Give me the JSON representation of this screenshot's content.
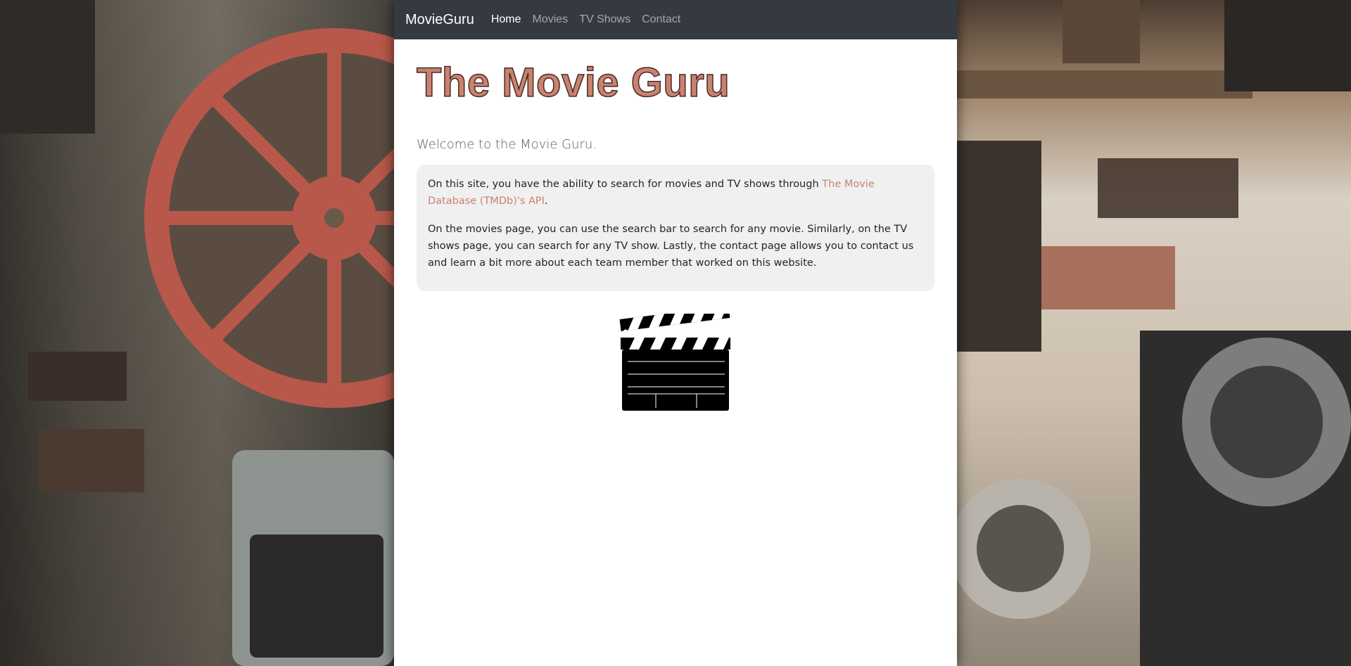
{
  "navbar": {
    "brand": "MovieGuru",
    "links": [
      {
        "label": "Home",
        "active": true
      },
      {
        "label": "Movies",
        "active": false
      },
      {
        "label": "TV Shows",
        "active": false
      },
      {
        "label": "Contact",
        "active": false
      }
    ]
  },
  "main": {
    "title": "The Movie Guru",
    "welcome": "Welcome to the Movie Guru.",
    "intro": {
      "before_link": "On this site, you have the ability to search for movies and TV shows through ",
      "link_text": "The Movie Database (TMDb)'s API",
      "after_link": "."
    },
    "description": "On the movies page, you can use the search bar to search for any movie. Similarly, on the TV shows page, you can search for any TV show. Lastly, the contact page allows you to contact us and learn a bit more about each team member that worked on this website.",
    "image": {
      "icon": "clapperboard-icon"
    }
  },
  "background": {
    "icon": "film-reel-icon"
  },
  "colors": {
    "accent": "#c98270",
    "navbar": "#343a40",
    "panel": "#f0f0f0"
  }
}
